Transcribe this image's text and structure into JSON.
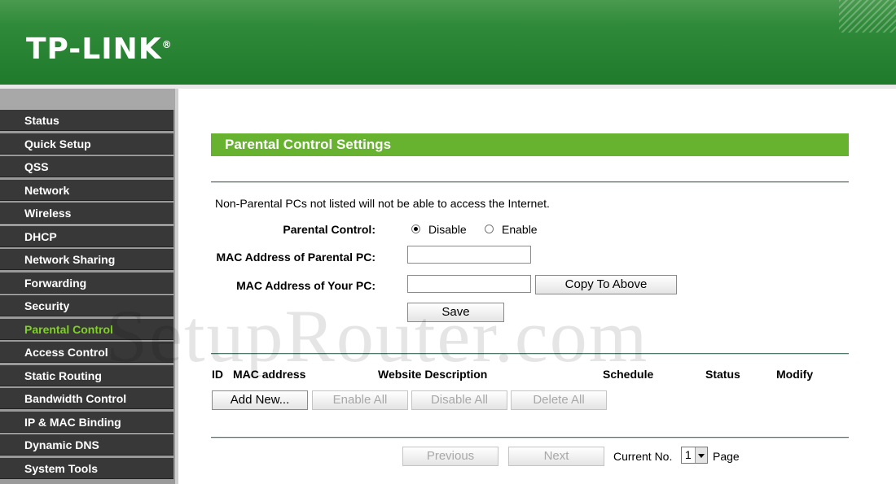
{
  "header": {
    "logo": "TP-LINK",
    "logo_mark": "®"
  },
  "sidebar": {
    "items": [
      {
        "label": "Status"
      },
      {
        "label": "Quick Setup"
      },
      {
        "label": "QSS"
      },
      {
        "label": "Network"
      },
      {
        "label": "Wireless"
      },
      {
        "label": "DHCP"
      },
      {
        "label": "Network Sharing"
      },
      {
        "label": "Forwarding"
      },
      {
        "label": "Security"
      },
      {
        "label": "Parental Control",
        "active": true
      },
      {
        "label": "Access Control"
      },
      {
        "label": "Static Routing"
      },
      {
        "label": "Bandwidth Control"
      },
      {
        "label": "IP & MAC Binding"
      },
      {
        "label": "Dynamic DNS"
      },
      {
        "label": "System Tools"
      }
    ]
  },
  "main": {
    "title": "Parental Control Settings",
    "note": "Non-Parental PCs not listed will not be able to access the Internet.",
    "parental_control": {
      "label": "Parental Control:",
      "options": [
        "Disable",
        "Enable"
      ],
      "selected": "Disable"
    },
    "mac_parental": {
      "label": "MAC Address of Parental PC:",
      "value": ""
    },
    "mac_yours": {
      "label": "MAC Address of Your PC:",
      "value": ""
    },
    "copy_button": "Copy To Above",
    "save_button": "Save",
    "table": {
      "headers": [
        "ID",
        "MAC address",
        "Website Description",
        "Schedule",
        "Status",
        "Modify"
      ],
      "buttons": {
        "add": "Add New...",
        "enable_all": "Enable All",
        "disable_all": "Disable All",
        "delete_all": "Delete All"
      }
    },
    "pager": {
      "previous": "Previous",
      "next": "Next",
      "current_label": "Current No.",
      "current": "1",
      "page_label": "Page"
    }
  },
  "watermark": "SetupRouter.com",
  "colors": {
    "header_green": "#2f8a39",
    "title_green": "#67b32f",
    "menu_bg": "#383838",
    "menu_active": "#7ed321"
  }
}
